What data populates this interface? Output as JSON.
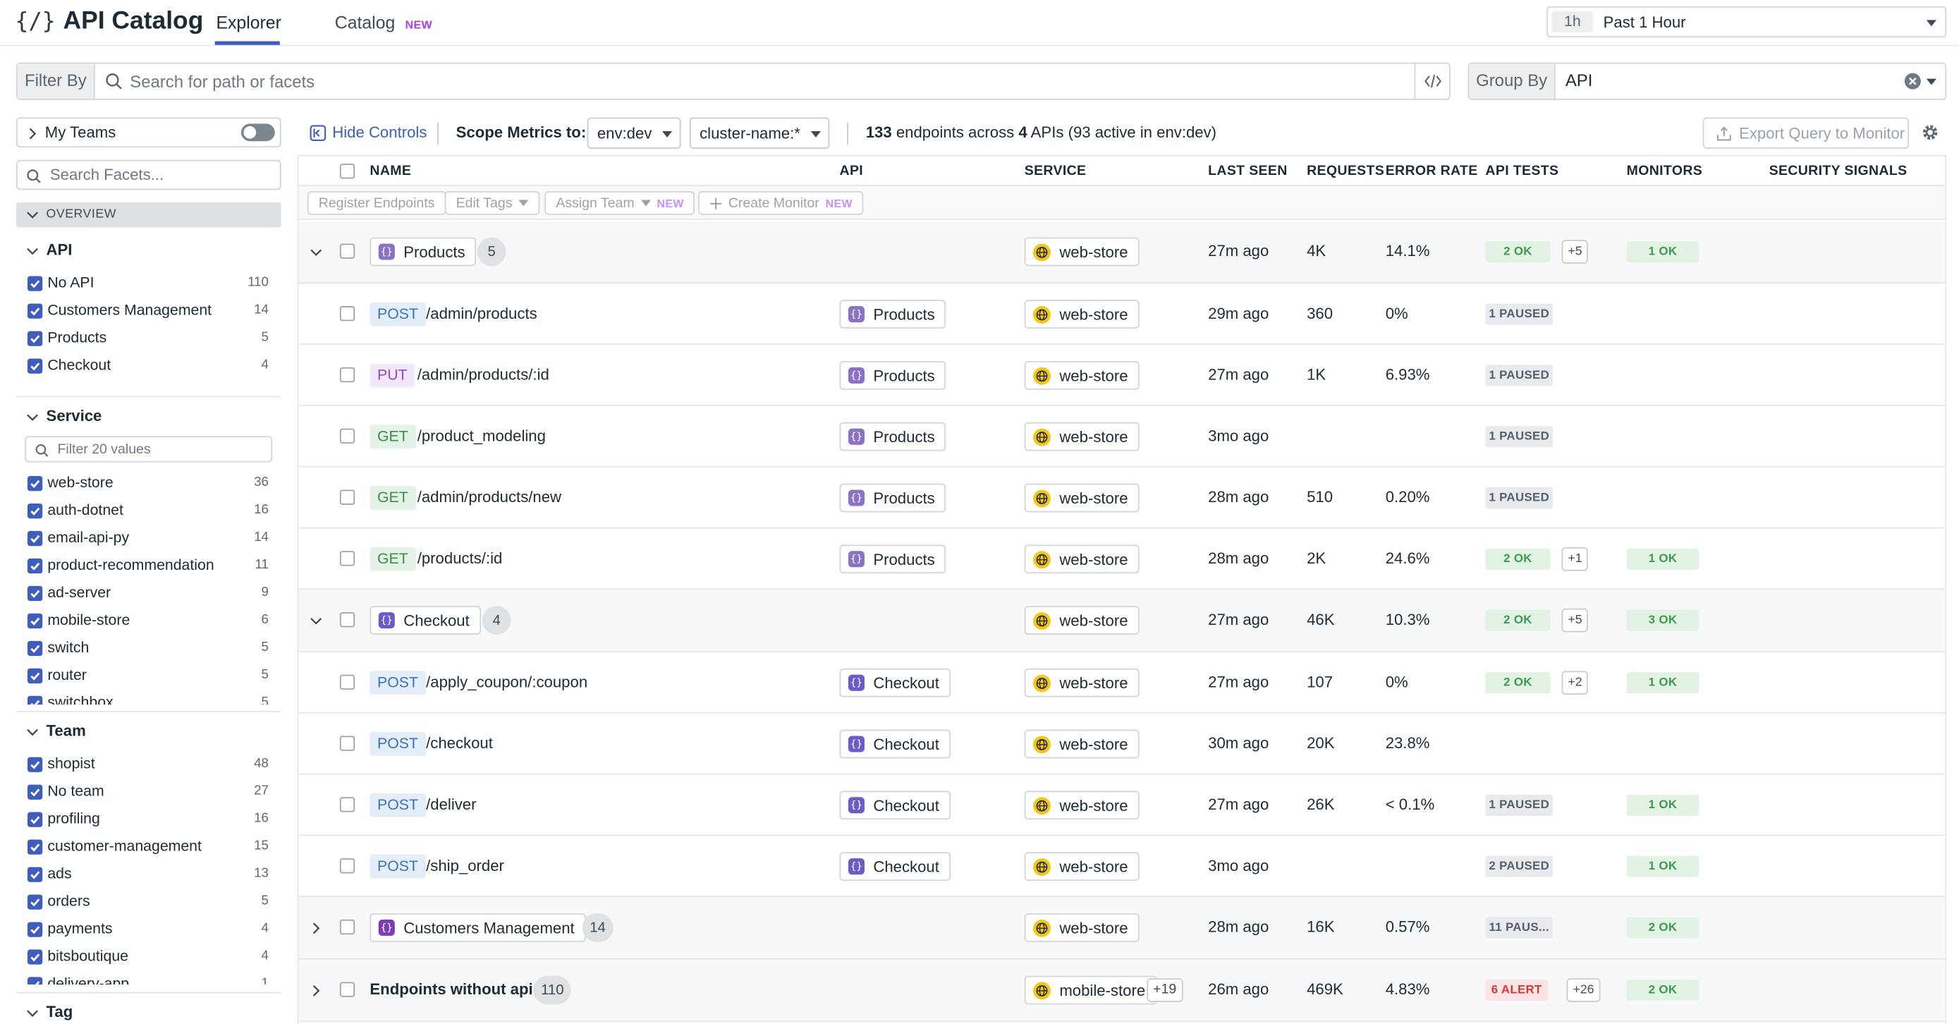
{
  "app": {
    "logo_glyph": "{/}",
    "title": "API Catalog",
    "tabs": [
      {
        "label": "Explorer",
        "active": true
      },
      {
        "label": "Catalog",
        "badge": "NEW"
      }
    ],
    "time": {
      "chip": "1h",
      "label": "Past 1 Hour"
    }
  },
  "filter": {
    "label": "Filter By",
    "placeholder": "Search for path or facets"
  },
  "group": {
    "label": "Group By",
    "value": "API"
  },
  "sidebar": {
    "my_teams": "My Teams",
    "facet_search_placeholder": "Search Facets...",
    "overview": "OVERVIEW",
    "api": {
      "title": "API",
      "items": [
        {
          "name": "No API",
          "count": "110"
        },
        {
          "name": "Customers Management",
          "count": "14"
        },
        {
          "name": "Products",
          "count": "5"
        },
        {
          "name": "Checkout",
          "count": "4"
        }
      ]
    },
    "service": {
      "title": "Service",
      "filter_placeholder": "Filter 20 values",
      "items": [
        {
          "name": "web-store",
          "count": "36"
        },
        {
          "name": "auth-dotnet",
          "count": "16"
        },
        {
          "name": "email-api-py",
          "count": "14"
        },
        {
          "name": "product-recommendation",
          "count": "11"
        },
        {
          "name": "ad-server",
          "count": "9"
        },
        {
          "name": "mobile-store",
          "count": "6"
        },
        {
          "name": "switch",
          "count": "5"
        },
        {
          "name": "router",
          "count": "5"
        },
        {
          "name": "switchbox",
          "count": "5"
        }
      ]
    },
    "team": {
      "title": "Team",
      "items": [
        {
          "name": "shopist",
          "count": "48"
        },
        {
          "name": "No team",
          "count": "27"
        },
        {
          "name": "profiling",
          "count": "16"
        },
        {
          "name": "customer-management",
          "count": "15"
        },
        {
          "name": "ads",
          "count": "13"
        },
        {
          "name": "orders",
          "count": "5"
        },
        {
          "name": "payments",
          "count": "4"
        },
        {
          "name": "bitsboutique",
          "count": "4"
        },
        {
          "name": "delivery-app",
          "count": "1"
        }
      ]
    },
    "tag": {
      "title": "Tag"
    }
  },
  "controls": {
    "hide_controls": "Hide Controls",
    "scope_label": "Scope Metrics to:",
    "env": "env:dev",
    "cluster": "cluster-name:*",
    "summary": {
      "endpoints": "133",
      "mid": " endpoints across ",
      "apis": "4",
      "tail": " APIs (93 active in env:dev)"
    },
    "export": "Export Query to Monitor"
  },
  "table": {
    "columns": {
      "name": "NAME",
      "api": "API",
      "service": "SERVICE",
      "last_seen": "LAST SEEN",
      "requests": "REQUESTS",
      "error_rate": "ERROR RATE",
      "api_tests": "API TESTS",
      "monitors": "MONITORS",
      "security_signals": "SECURITY SIGNALS"
    },
    "bulk": {
      "register": "Register Endpoints",
      "edit_tags": "Edit Tags",
      "assign_team": "Assign Team",
      "assign_badge": "NEW",
      "create_monitor": "Create Monitor",
      "create_badge": "NEW"
    },
    "rows": [
      {
        "kind": "group",
        "expanded": true,
        "name": "Products",
        "count": "5",
        "api_color": "#8a72c4",
        "service": "web-store",
        "last_seen": "27m ago",
        "requests": "4K",
        "error_rate": "14.1%",
        "tests": "2 OK",
        "tests_kind": "ok",
        "tests_extra": "+5",
        "monitor": "1 OK"
      },
      {
        "kind": "endpoint",
        "method": "POST",
        "path": "/admin/products",
        "api": "Products",
        "api_color": "#8a72c4",
        "service": "web-store",
        "last_seen": "29m ago",
        "requests": "360",
        "error_rate": "0%",
        "tests": "1 PAUSED",
        "tests_kind": "paused"
      },
      {
        "kind": "endpoint",
        "method": "PUT",
        "path": "/admin/products/:id",
        "api": "Products",
        "api_color": "#8a72c4",
        "service": "web-store",
        "last_seen": "27m ago",
        "requests": "1K",
        "error_rate": "6.93%",
        "tests": "1 PAUSED",
        "tests_kind": "paused"
      },
      {
        "kind": "endpoint",
        "method": "GET",
        "path": "/product_modeling",
        "api": "Products",
        "api_color": "#8a72c4",
        "service": "web-store",
        "last_seen": "3mo ago",
        "tests": "1 PAUSED",
        "tests_kind": "paused"
      },
      {
        "kind": "endpoint",
        "method": "GET",
        "path": "/admin/products/new",
        "api": "Products",
        "api_color": "#8a72c4",
        "service": "web-store",
        "last_seen": "28m ago",
        "requests": "510",
        "error_rate": "0.20%",
        "tests": "1 PAUSED",
        "tests_kind": "paused"
      },
      {
        "kind": "endpoint",
        "method": "GET",
        "path": "/products/:id",
        "api": "Products",
        "api_color": "#8a72c4",
        "service": "web-store",
        "last_seen": "28m ago",
        "requests": "2K",
        "error_rate": "24.6%",
        "tests": "2 OK",
        "tests_kind": "ok",
        "tests_extra": "+1",
        "monitor": "1 OK"
      },
      {
        "kind": "group",
        "expanded": true,
        "name": "Checkout",
        "count": "4",
        "api_color": "#6a5cc8",
        "service": "web-store",
        "last_seen": "27m ago",
        "requests": "46K",
        "error_rate": "10.3%",
        "tests": "2 OK",
        "tests_kind": "ok",
        "tests_extra": "+5",
        "monitor": "3 OK"
      },
      {
        "kind": "endpoint",
        "method": "POST",
        "path": "/apply_coupon/:coupon",
        "api": "Checkout",
        "api_color": "#6a5cc8",
        "service": "web-store",
        "last_seen": "27m ago",
        "requests": "107",
        "error_rate": "0%",
        "tests": "2 OK",
        "tests_kind": "ok",
        "tests_extra": "+2",
        "monitor": "1 OK"
      },
      {
        "kind": "endpoint",
        "method": "POST",
        "path": "/checkout",
        "api": "Checkout",
        "api_color": "#6a5cc8",
        "service": "web-store",
        "last_seen": "30m ago",
        "requests": "20K",
        "error_rate": "23.8%"
      },
      {
        "kind": "endpoint",
        "method": "POST",
        "path": "/deliver",
        "api": "Checkout",
        "api_color": "#6a5cc8",
        "service": "web-store",
        "last_seen": "27m ago",
        "requests": "26K",
        "error_rate": "< 0.1%",
        "tests": "1 PAUSED",
        "tests_kind": "paused",
        "monitor": "1 OK"
      },
      {
        "kind": "endpoint",
        "method": "POST",
        "path": "/ship_order",
        "api": "Checkout",
        "api_color": "#6a5cc8",
        "service": "web-store",
        "last_seen": "3mo ago",
        "tests": "2 PAUSED",
        "tests_kind": "paused",
        "monitor": "1 OK"
      },
      {
        "kind": "group",
        "expanded": false,
        "name": "Customers Management",
        "count": "14",
        "api_color": "#7a3fb5",
        "service": "web-store",
        "last_seen": "28m ago",
        "requests": "16K",
        "error_rate": "0.57%",
        "tests": "11 PAUS...",
        "tests_kind": "paused",
        "monitor": "2 OK"
      },
      {
        "kind": "group",
        "expanded": false,
        "noapi": true,
        "name": "Endpoints without api",
        "count": "110",
        "service": "mobile-store",
        "service_extra": "+19",
        "last_seen": "26m ago",
        "requests": "469K",
        "error_rate": "4.83%",
        "tests": "6 ALERT",
        "tests_kind": "alert",
        "tests_extra": "+26",
        "monitor": "2 OK"
      }
    ]
  },
  "colors": {
    "accent": "#3f5ebc",
    "new_badge": "#a53df5",
    "service_icon": "#f5c518",
    "ok": "#3c9a4f",
    "alert": "#d13a3a"
  }
}
